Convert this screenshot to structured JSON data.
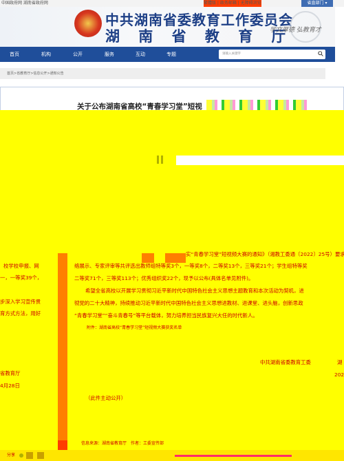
{
  "topbar": {
    "left": "中国政府网 湖南省政府网",
    "right": "繁體版 | 政务邮箱 | 无障碍浏览",
    "switch": "省直部门 ▾"
  },
  "header": {
    "title_line1": "中共湖南省委教育工作委员会",
    "title_line2": "湖 南 省 教 育 厅",
    "calligraphy": "学文厚德 弘教育才"
  },
  "nav": {
    "items": [
      "首页",
      "机构",
      "公开",
      "服务",
      "互动",
      "专题"
    ],
    "search_placeholder": "请输入关键字"
  },
  "breadcrumb": "首页>省教育厅>信息公开>通知公告",
  "article": {
    "title": "关于公布湖南省高校“青春学习堂”短视",
    "partial_notice": "实“青春学习堂”短视频大赛的通知》（湘教工委通〔2022〕25号）要求要",
    "left_col": [
      "校学校申报、网",
      "一，一等奖39个，",
      "",
      "步深入学习宣传贯",
      "育方式方法，用好"
    ],
    "left_sign": [
      "省教育厅",
      "4月28日"
    ],
    "para1": [
      "络展示、专家评审等共评选出教师组特等奖3个，一等奖8个，二等奖13个，三等奖21个；学生组特等奖",
      "二等奖71个，三等奖113个；优秀组织奖22个，现予以公布(具体名单见附件)。"
    ],
    "para2": [
      "希望全省高校以开展学习贯彻习近平新时代中国特色社会主义思想主题教育和本次活动为契机，进",
      "彻党的二十大精神，持续推动习近平新时代中国特色社会主义思想进教材、进课堂、进头脑，创新思政",
      "“青春学习堂”“奋斗青春号”等平台载体，努力培养担当民族复兴大任的时代新人。"
    ],
    "attachment": "附件：湖南省高校“青春学习堂”短视频大赛获奖名单",
    "sign_org": "中共湖南省委教育工委",
    "sign_org_right": "湖",
    "sign_year": "202",
    "public_note": "（此件主动公开）",
    "source_line": "信息来源：湖南省教育厅　作者：工委宣传部",
    "share_label": "分享"
  }
}
